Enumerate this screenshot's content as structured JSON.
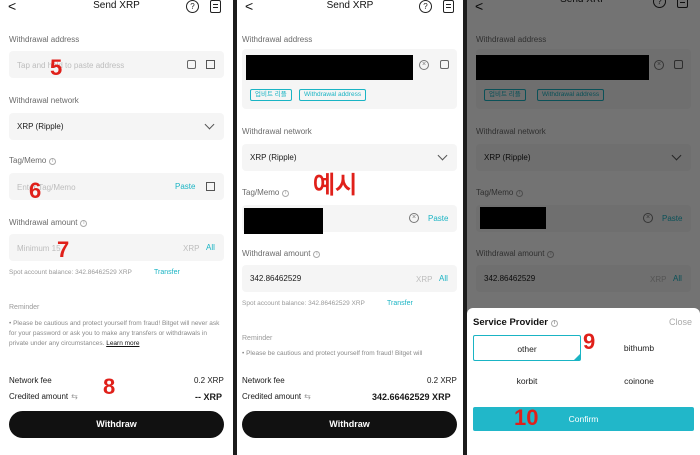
{
  "screen": {
    "title": "Send XRP",
    "back_glyph": "<",
    "help_glyph": "?"
  },
  "colors": {
    "accent": "#1ab4c4",
    "annotation": "#e0201a",
    "primary_button": "#111111",
    "confirm_button": "#21b7c9"
  },
  "labels": {
    "withdrawal_address": "Withdrawal address",
    "withdrawal_network": "Withdrawal network",
    "tag_memo": "Tag/Memo",
    "withdrawal_amount": "Withdrawal amount",
    "reminder": "Reminder",
    "network_fee": "Network fee",
    "credited_amount": "Credited amount"
  },
  "placeholders": {
    "address": "Tap and hold to paste address",
    "tag": "Enter Tag/Memo",
    "amount": "Minimum 15"
  },
  "values": {
    "network": "XRP (Ripple)",
    "amount": "342.86462529",
    "amount_unit": "XRP",
    "balance_text": "Spot account balance: 342.86462529 XRP",
    "fee": "0.2 XRP",
    "credited_empty": "-- XRP",
    "credited_full": "342.66462529 XRP",
    "all": "All",
    "paste": "Paste",
    "transfer": "Transfer",
    "clear_glyph": "×"
  },
  "tags": {
    "upbit": "업비트 리플",
    "withdrawal_address": "Withdrawal address"
  },
  "reminder": {
    "full": "• Please be cautious and protect yourself from fraud! Bitget will never ask for your password or ask you to make any transfers or withdrawals in private under any circumstances.",
    "learn_more": "Learn more",
    "short": "• Please be cautious and protect yourself from fraud! Bitget will"
  },
  "buttons": {
    "withdraw": "Withdraw",
    "confirm": "Confirm"
  },
  "service_provider": {
    "title": "Service Provider",
    "close": "Close",
    "options": [
      "other",
      "bithumb",
      "korbit",
      "coinone"
    ],
    "selected": "other"
  },
  "annotations": {
    "n5": "5",
    "n6": "6",
    "n7": "7",
    "n8": "8",
    "n9": "9",
    "n10": "10",
    "example": "예시"
  }
}
